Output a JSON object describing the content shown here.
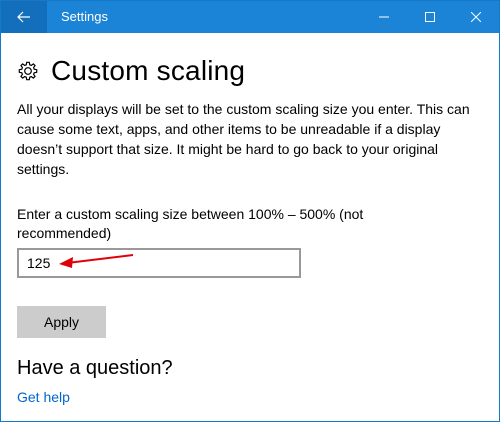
{
  "window": {
    "title": "Settings",
    "accent_color": "#1b84d7",
    "back_icon": "back-arrow-icon",
    "controls": [
      "minimize-icon",
      "maximize-icon",
      "close-icon"
    ]
  },
  "page": {
    "icon": "gear-icon",
    "title": "Custom scaling",
    "description": "All your displays will be set to the custom scaling size you enter. This can cause some text, apps, and other items to be unreadable if a display doesn’t support that size. It might be hard to go back to your original settings."
  },
  "scaling": {
    "label": "Enter a custom scaling size between 100% – 500% (not recommended)",
    "value": "125",
    "annotation_color": "#e0000a"
  },
  "actions": {
    "apply_label": "Apply"
  },
  "help": {
    "heading": "Have a question?",
    "link_label": "Get help",
    "link_color": "#0066cc"
  }
}
